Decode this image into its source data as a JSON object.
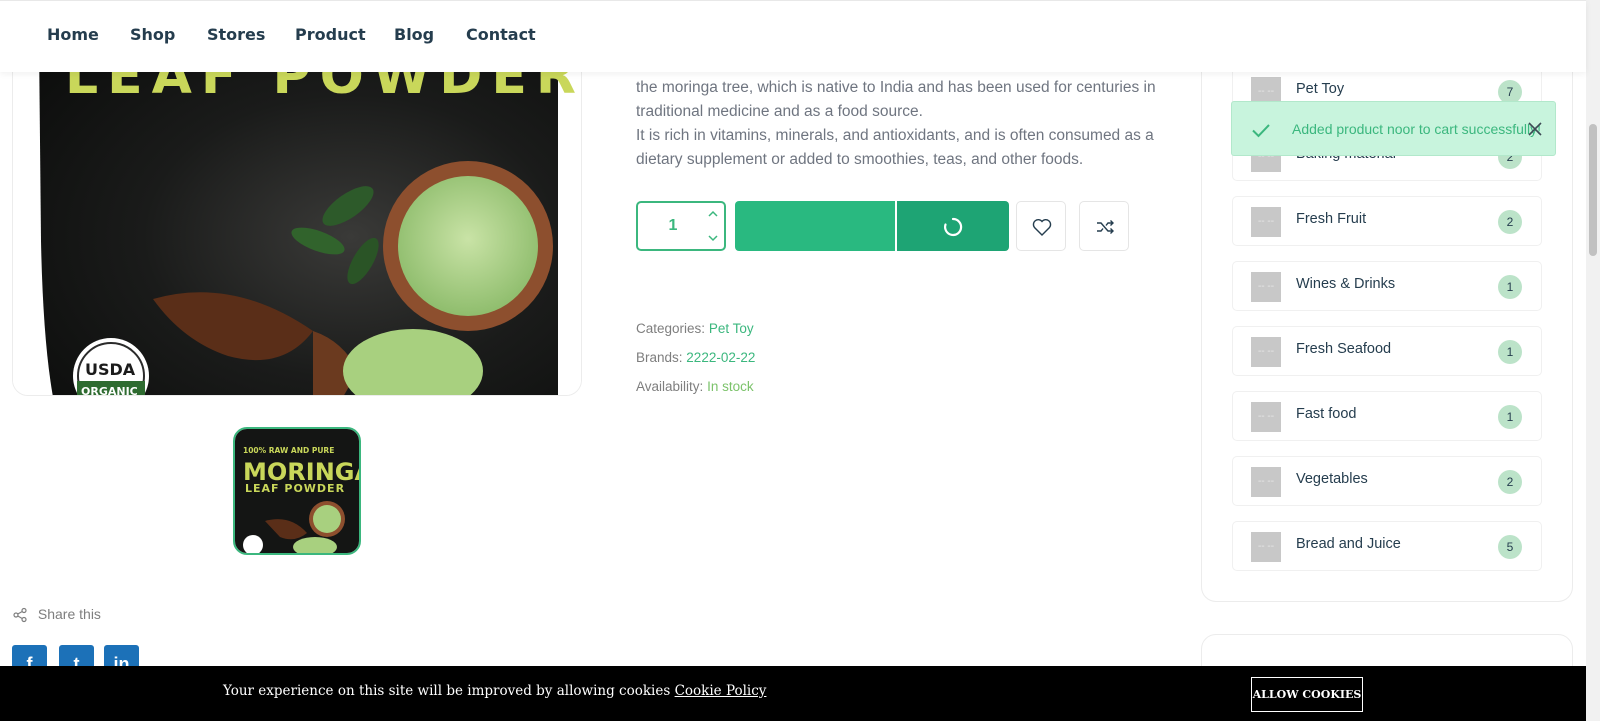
{
  "nav": {
    "items": [
      {
        "label": "Home"
      },
      {
        "label": "Shop"
      },
      {
        "label": "Stores"
      },
      {
        "label": "Product"
      },
      {
        "label": "Blog"
      },
      {
        "label": "Contact"
      }
    ]
  },
  "product": {
    "image_text_line1": "LEAF POWDER",
    "image_badge": "USDA",
    "image_badge_sub": "ORGANIC",
    "thumb_line1": "100% RAW AND PURE",
    "thumb_line2": "MORINGA",
    "thumb_line3": "LEAF POWDER",
    "description": [
      "the moringa tree, which is native to India and has been used for centuries in traditional medicine and as a food source.",
      "It is rich in vitamins, minerals, and antioxidants, and is often consumed as a dietary supplement or added to smoothies, teas, and other foods."
    ],
    "quantity": "1",
    "meta": {
      "categories_label": "Categories:",
      "categories_value": "Pet Toy",
      "brands_label": "Brands:",
      "brands_value": "2222-02-22",
      "availability_label": "Availability:",
      "availability_value": "In stock"
    },
    "share_label": "Share this",
    "social": [
      {
        "icon": "facebook-icon",
        "glyph": "f"
      },
      {
        "icon": "twitter-icon",
        "glyph": "t"
      },
      {
        "icon": "linkedin-icon",
        "glyph": "in"
      }
    ]
  },
  "sidebar": {
    "categories": [
      {
        "name": "Pet Toy",
        "count": "7"
      },
      {
        "name": "Baking material",
        "count": "2"
      },
      {
        "name": "Fresh Fruit",
        "count": "2"
      },
      {
        "name": "Wines & Drinks",
        "count": "1"
      },
      {
        "name": "Fresh Seafood",
        "count": "1"
      },
      {
        "name": "Fast food",
        "count": "1"
      },
      {
        "name": "Vegetables",
        "count": "2"
      },
      {
        "name": "Bread and Juice",
        "count": "5"
      }
    ],
    "placeholder_glyph": "-- --"
  },
  "toast": {
    "message": "Added product noor to cart successfully!"
  },
  "cookie": {
    "text": "Your experience on this site will be improved by allowing cookies",
    "link": "Cookie Policy",
    "button": "ALLOW COOKIES"
  },
  "colors": {
    "brand": "#3bb77e",
    "cart_button": "#29b980",
    "buy_button": "#1ea474",
    "badge_bg": "#bce3c9",
    "toast_bg": "#c8f4dd",
    "cookie_bg": "#000000"
  }
}
